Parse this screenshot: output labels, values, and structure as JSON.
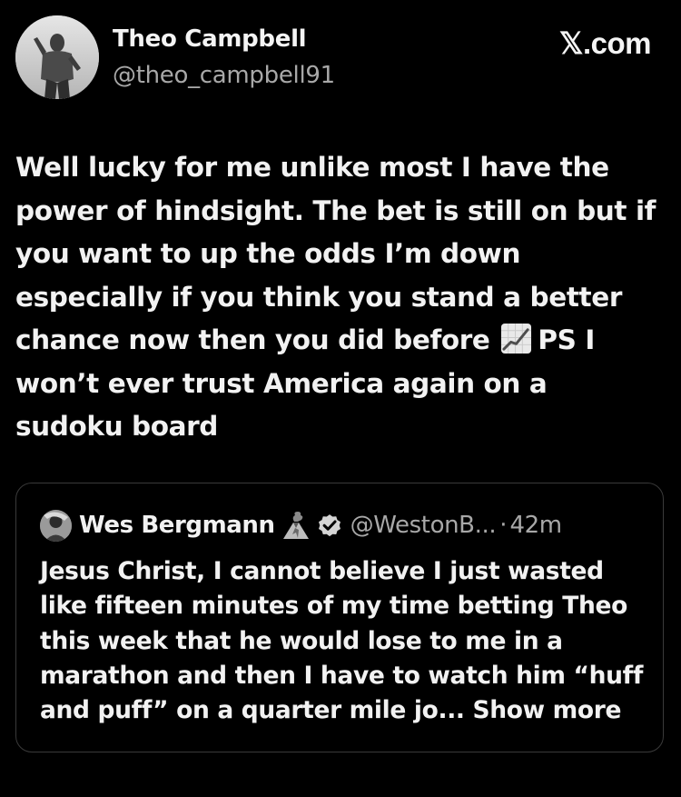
{
  "header": {
    "display_name": "Theo Campbell",
    "handle": "@theo_campbell91",
    "site": "𝕏.com"
  },
  "tweet": {
    "text_before_emoji": "Well lucky for me unlike most I have the\npower of hindsight. The bet is still on but if\nyou want to up the odds I’m down\nespecially if you think you stand a better\nchance now then you did before",
    "emoji": "chart-increasing-icon",
    "text_after_emoji": "PS I\nwon’t ever trust America again on a\nsudoku board"
  },
  "quoted_tweet": {
    "display_name": "Wes Bergmann",
    "handle": "@WestonB...",
    "separator": "·",
    "time": "42m",
    "body": "Jesus Christ, I cannot believe I just wasted\nlike fifteen minutes of my time betting Theo\nthis week that he would lose to me in a\nmarathon and then I have to watch him “huff\nand puff” on a quarter mile jo... Show more"
  },
  "colors": {
    "background": "#000000",
    "primary_text": "#f2f2f2",
    "secondary_text": "#a8a8a8",
    "card_border": "#3a3a3a"
  }
}
